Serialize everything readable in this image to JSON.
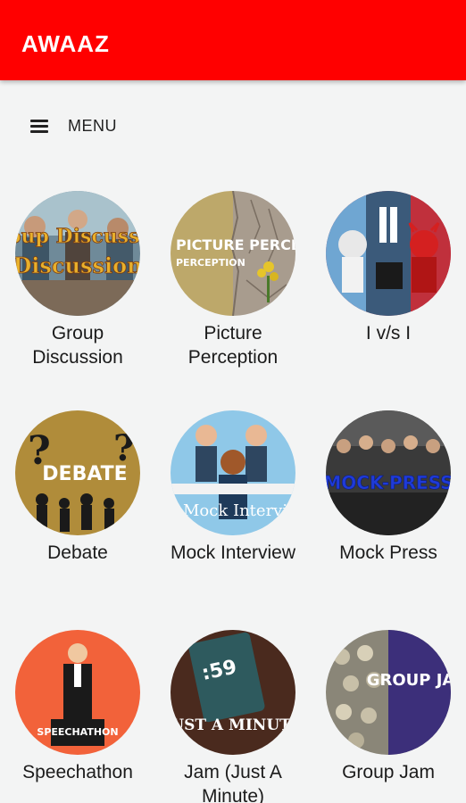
{
  "appbar": {
    "title": "AWAAZ",
    "color": "#ff0000"
  },
  "menu": {
    "label": "MENU",
    "icon": "hamburger-menu-icon"
  },
  "events": [
    {
      "label": "Group Discussion",
      "image_text": "Group Discussion"
    },
    {
      "label": "Picture Perception",
      "image_text": "PICTURE PERCEPTION"
    },
    {
      "label": "I v/s I",
      "image_text": ""
    },
    {
      "label": "Debate",
      "image_text": "DEBATE"
    },
    {
      "label": "Mock Interview",
      "image_text": "Mock Intervie"
    },
    {
      "label": "Mock Press",
      "image_text": "MOCK-PRESS"
    },
    {
      "label": "Speechathon",
      "image_text": "SPEECHATHON"
    },
    {
      "label": "Jam (Just A Minute)",
      "image_text": "JUST A MINUTE"
    },
    {
      "label": "Group Jam",
      "image_text": "GROUP JAM"
    }
  ]
}
